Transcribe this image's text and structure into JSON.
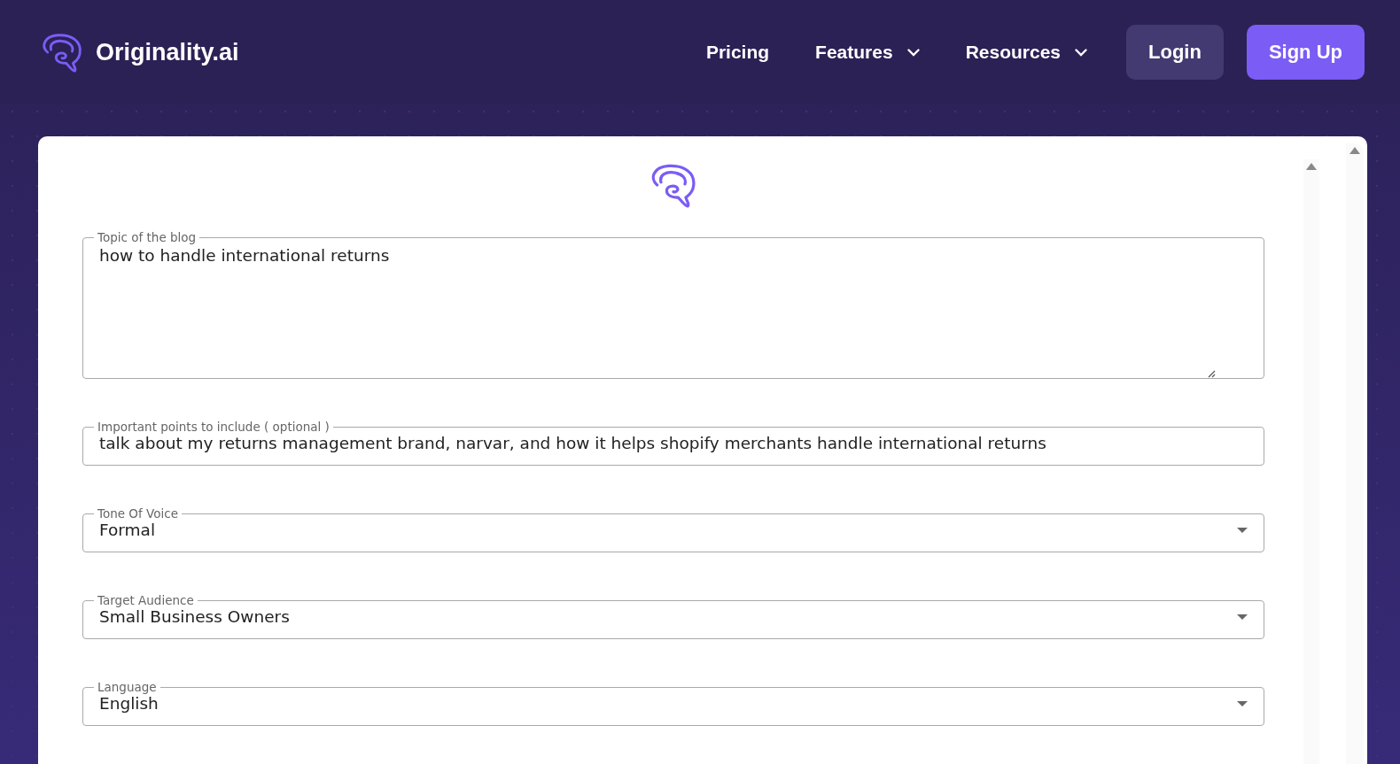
{
  "header": {
    "logo_text": "Originality.ai",
    "nav": [
      {
        "label": "Pricing",
        "has_menu": false
      },
      {
        "label": "Features",
        "has_menu": true
      },
      {
        "label": "Resources",
        "has_menu": true
      }
    ],
    "buttons": [
      {
        "label": "Login",
        "kind": "secondary"
      },
      {
        "label": "Sign Up",
        "kind": "primary"
      }
    ]
  },
  "form": {
    "fields": [
      {
        "kind": "textarea",
        "label": "Topic of the blog",
        "value": "how to handle international returns"
      },
      {
        "kind": "text",
        "label": "Important points to include ( optional )",
        "value": "talk about my returns management brand, narvar, and how it helps shopify merchants handle international returns"
      },
      {
        "kind": "select",
        "label": "Tone Of Voice",
        "value": "Formal"
      },
      {
        "kind": "select",
        "label": "Target Audience",
        "value": "Small Business Owners"
      },
      {
        "kind": "select",
        "label": "Language",
        "value": "English"
      }
    ]
  }
}
